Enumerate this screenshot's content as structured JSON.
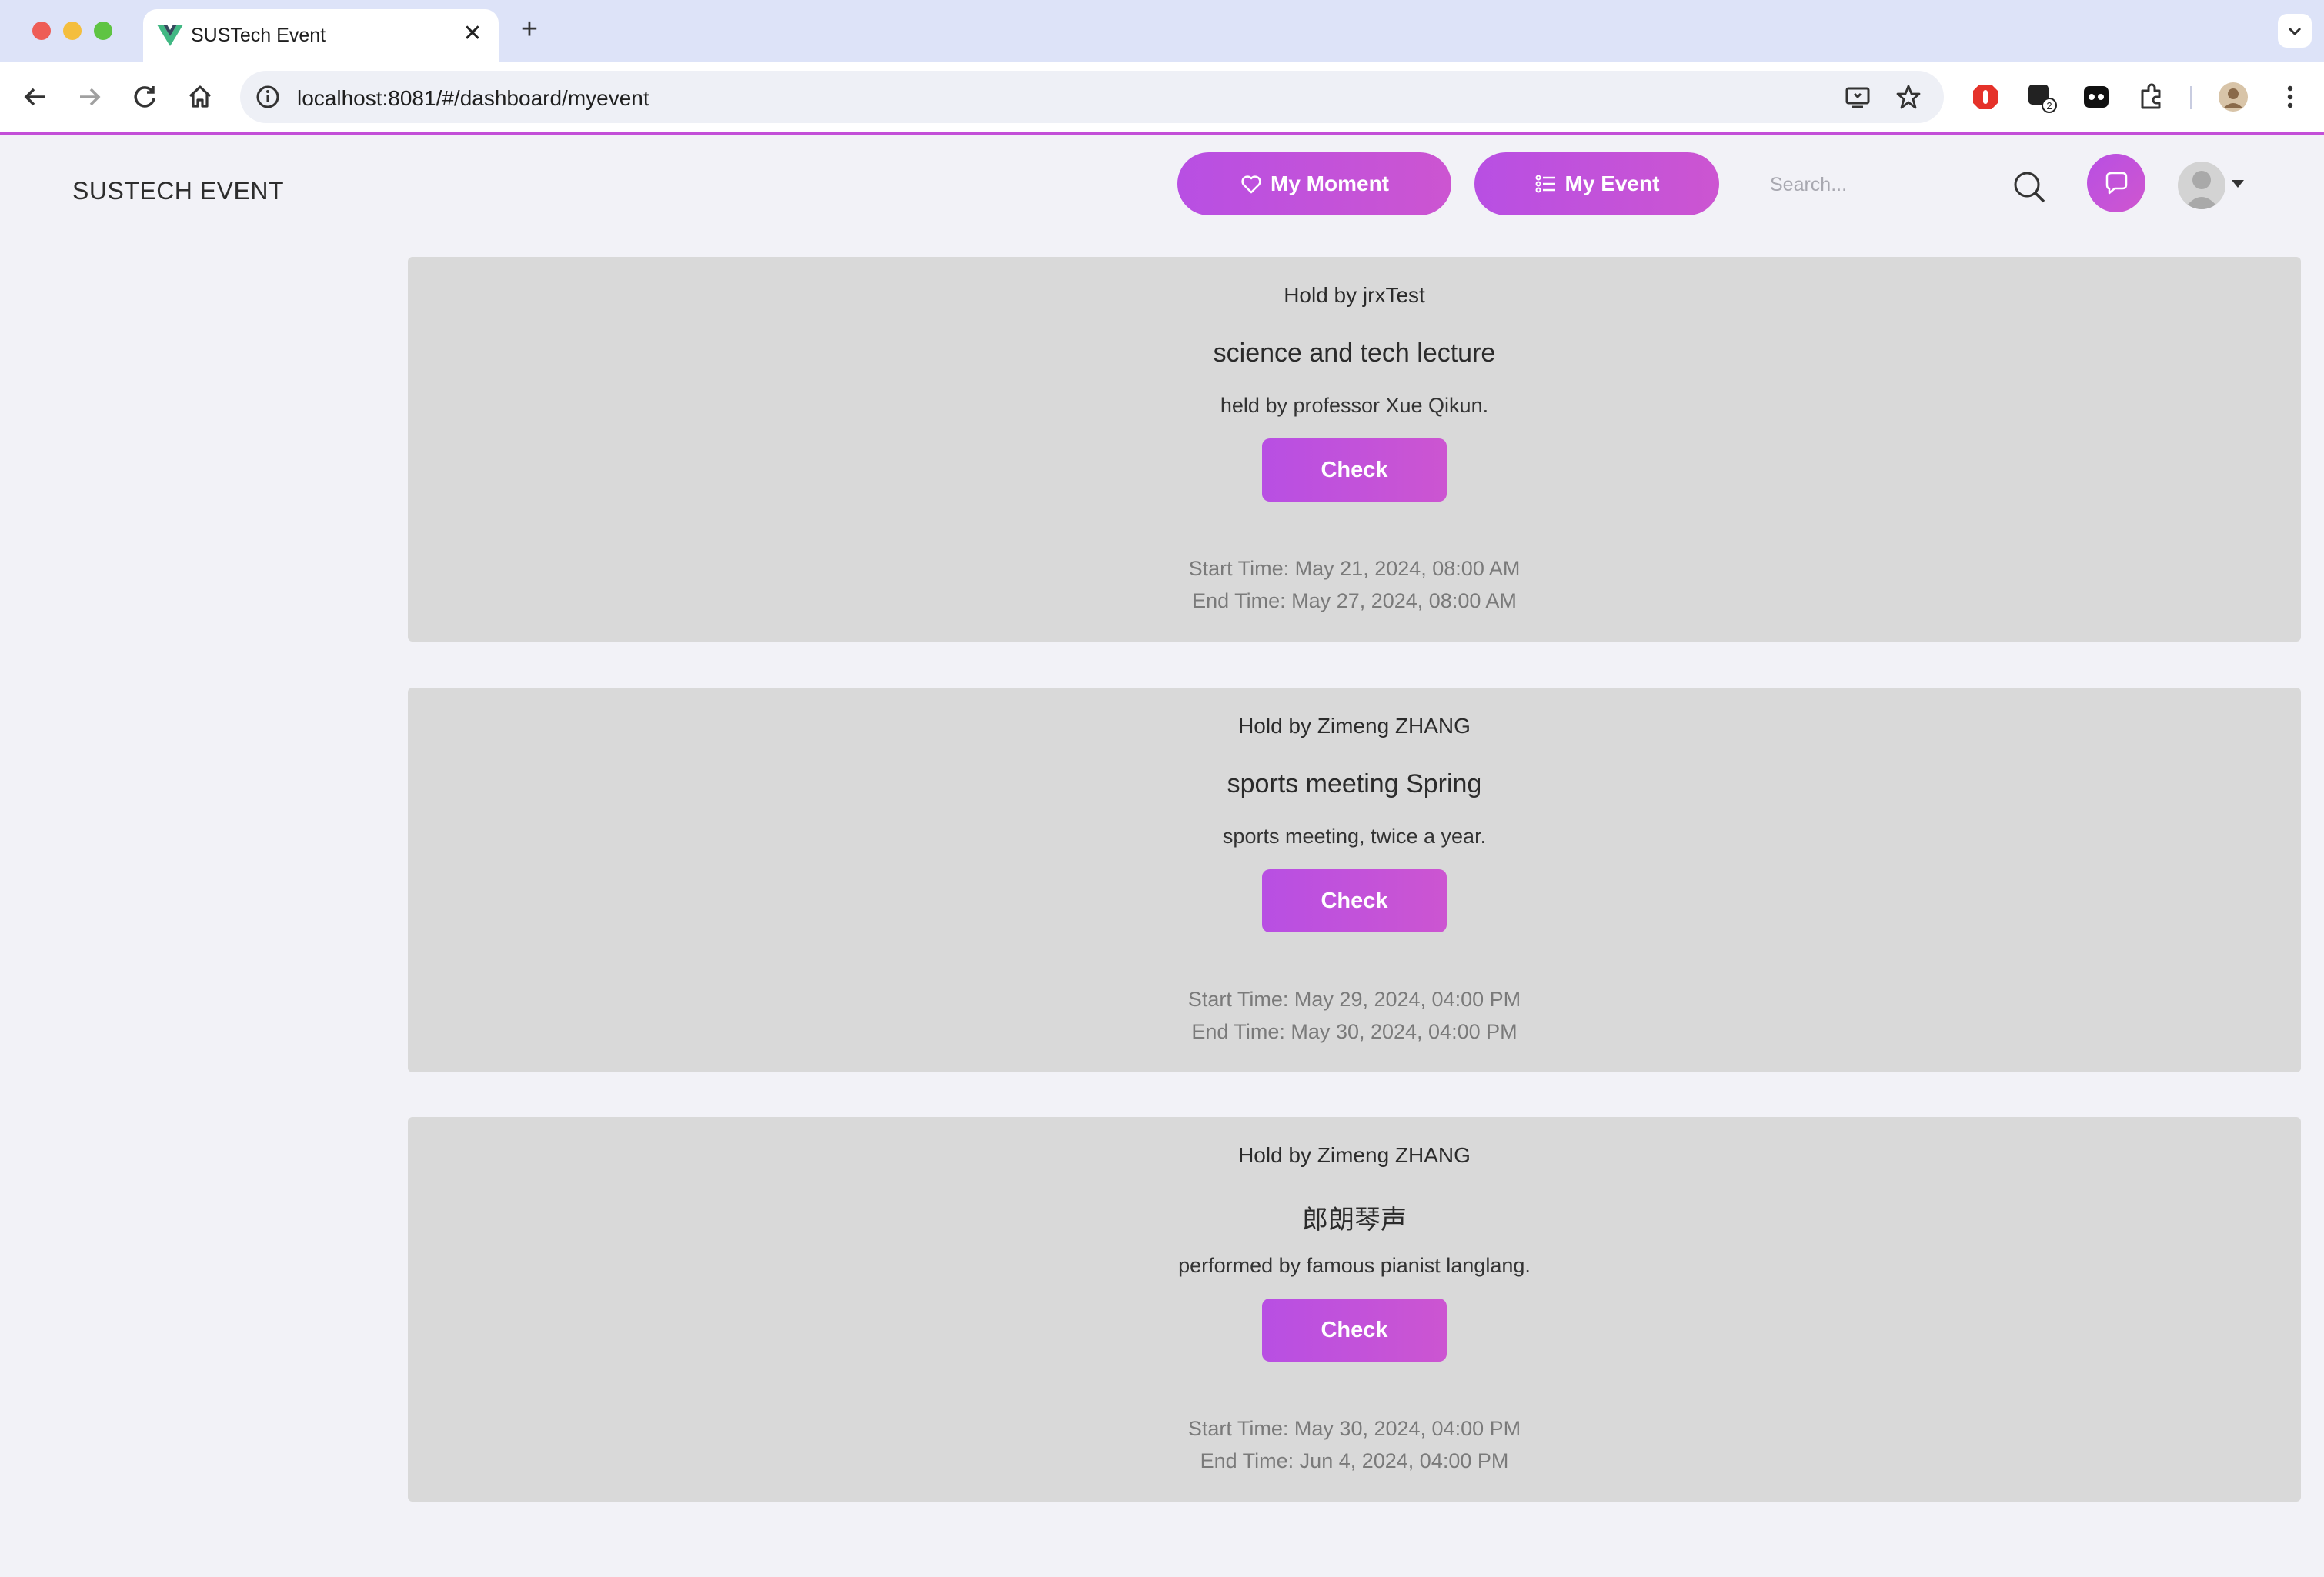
{
  "browser": {
    "tab_title": "SUSTech Event",
    "url": "localhost:8081/#/dashboard/myevent"
  },
  "header": {
    "brand": "SUSTECH EVENT",
    "my_moment_label": "My Moment",
    "my_event_label": "My Event",
    "search_placeholder": "Search..."
  },
  "events": [
    {
      "hold": "Hold by jrxTest",
      "title": "science and tech lecture",
      "description": "held by professor Xue Qikun.",
      "button": "Check",
      "start": "Start Time: May 21, 2024, 08:00 AM",
      "end": "End Time: May 27, 2024, 08:00 AM"
    },
    {
      "hold": "Hold by Zimeng ZHANG",
      "title": "sports meeting Spring",
      "description": "sports meeting, twice a year.",
      "button": "Check",
      "start": "Start Time: May 29, 2024, 04:00 PM",
      "end": "End Time: May 30, 2024, 04:00 PM"
    },
    {
      "hold": "Hold by Zimeng ZHANG",
      "title": "郎朗琴声",
      "description": "performed by famous pianist langlang.",
      "button": "Check",
      "start": "Start Time: May 30, 2024, 04:00 PM",
      "end": "End Time: Jun 4, 2024, 04:00 PM"
    }
  ],
  "colors": {
    "accent": "#c34fd8",
    "card_bg": "#d9d9d9",
    "page_bg": "#f2f2f7"
  }
}
